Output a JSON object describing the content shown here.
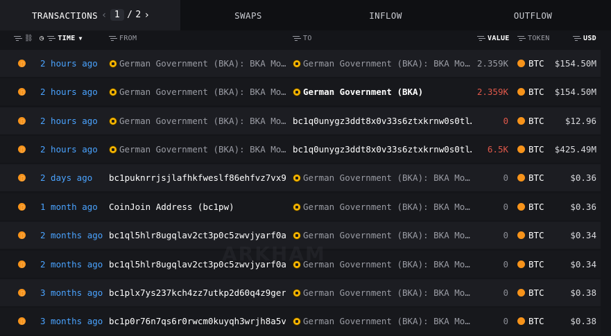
{
  "tabs": {
    "transactions": "TRANSACTIONS",
    "page_current": "1",
    "page_sep": "/",
    "page_total": "2",
    "swaps": "SWAPS",
    "inflow": "INFLOW",
    "outflow": "OUTFLOW"
  },
  "columns": {
    "time": "TIME",
    "from": "FROM",
    "to": "TO",
    "value": "VALUE",
    "token": "TOKEN",
    "usd": "USD"
  },
  "watermark": "ARKHAM",
  "rows": [
    {
      "time": "2 hours ago",
      "from": "German Government (BKA): BKA Mo…",
      "from_icon": true,
      "from_bold": false,
      "to": "German Government (BKA): BKA Mo…",
      "to_icon": true,
      "to_bold": false,
      "value": "2.359K",
      "value_style": "muted",
      "token": "BTC",
      "usd": "$154.50M"
    },
    {
      "time": "2 hours ago",
      "from": "German Government (BKA): BKA Mo…",
      "from_icon": true,
      "from_bold": false,
      "to": "German Government (BKA)",
      "to_icon": true,
      "to_bold": true,
      "value": "2.359K",
      "value_style": "red",
      "token": "BTC",
      "usd": "$154.50M"
    },
    {
      "time": "2 hours ago",
      "from": "German Government (BKA): BKA Mo…",
      "from_icon": true,
      "from_bold": false,
      "to": "bc1q0unygz3ddt8x0v33s6ztxkrnw0s0tl…",
      "to_icon": false,
      "to_bold": false,
      "value": "0",
      "value_style": "red",
      "token": "BTC",
      "usd": "$12.96"
    },
    {
      "time": "2 hours ago",
      "from": "German Government (BKA): BKA Mo…",
      "from_icon": true,
      "from_bold": false,
      "to": "bc1q0unygz3ddt8x0v33s6ztxkrnw0s0tl…",
      "to_icon": false,
      "to_bold": false,
      "value": "6.5K",
      "value_style": "red",
      "token": "BTC",
      "usd": "$425.49M"
    },
    {
      "time": "2 days ago",
      "from": "bc1puknrrjsjlafhkfweslf86ehfvz7vx9…",
      "from_icon": false,
      "from_bold": false,
      "to": "German Government (BKA): BKA Mo…",
      "to_icon": true,
      "to_bold": false,
      "value": "0",
      "value_style": "dim",
      "token": "BTC",
      "usd": "$0.36"
    },
    {
      "time": "1 month ago",
      "from": "CoinJoin Address (bc1pw)",
      "from_icon": false,
      "from_bold": false,
      "to": "German Government (BKA): BKA Mo…",
      "to_icon": true,
      "to_bold": false,
      "value": "0",
      "value_style": "dim",
      "token": "BTC",
      "usd": "$0.36"
    },
    {
      "time": "2 months ago",
      "from": "bc1ql5hlr8ugqlav2ct3p0c5zwvjyarf0a…",
      "from_icon": false,
      "from_bold": false,
      "to": "German Government (BKA): BKA Mo…",
      "to_icon": true,
      "to_bold": false,
      "value": "0",
      "value_style": "dim",
      "token": "BTC",
      "usd": "$0.34"
    },
    {
      "time": "2 months ago",
      "from": "bc1ql5hlr8ugqlav2ct3p0c5zwvjyarf0a…",
      "from_icon": false,
      "from_bold": false,
      "to": "German Government (BKA): BKA Mo…",
      "to_icon": true,
      "to_bold": false,
      "value": "0",
      "value_style": "dim",
      "token": "BTC",
      "usd": "$0.34"
    },
    {
      "time": "3 months ago",
      "from": "bc1plx7ys237kch4zz7utkp2d60q4z9ger…",
      "from_icon": false,
      "from_bold": false,
      "to": "German Government (BKA): BKA Mo…",
      "to_icon": true,
      "to_bold": false,
      "value": "0",
      "value_style": "dim",
      "token": "BTC",
      "usd": "$0.38"
    },
    {
      "time": "3 months ago",
      "from": "bc1p0r76n7qs6r0rwcm0kuyqh3wrjh8a5v…",
      "from_icon": false,
      "from_bold": false,
      "to": "German Government (BKA): BKA Mo…",
      "to_icon": true,
      "to_bold": false,
      "value": "0",
      "value_style": "dim",
      "token": "BTC",
      "usd": "$0.38"
    }
  ]
}
